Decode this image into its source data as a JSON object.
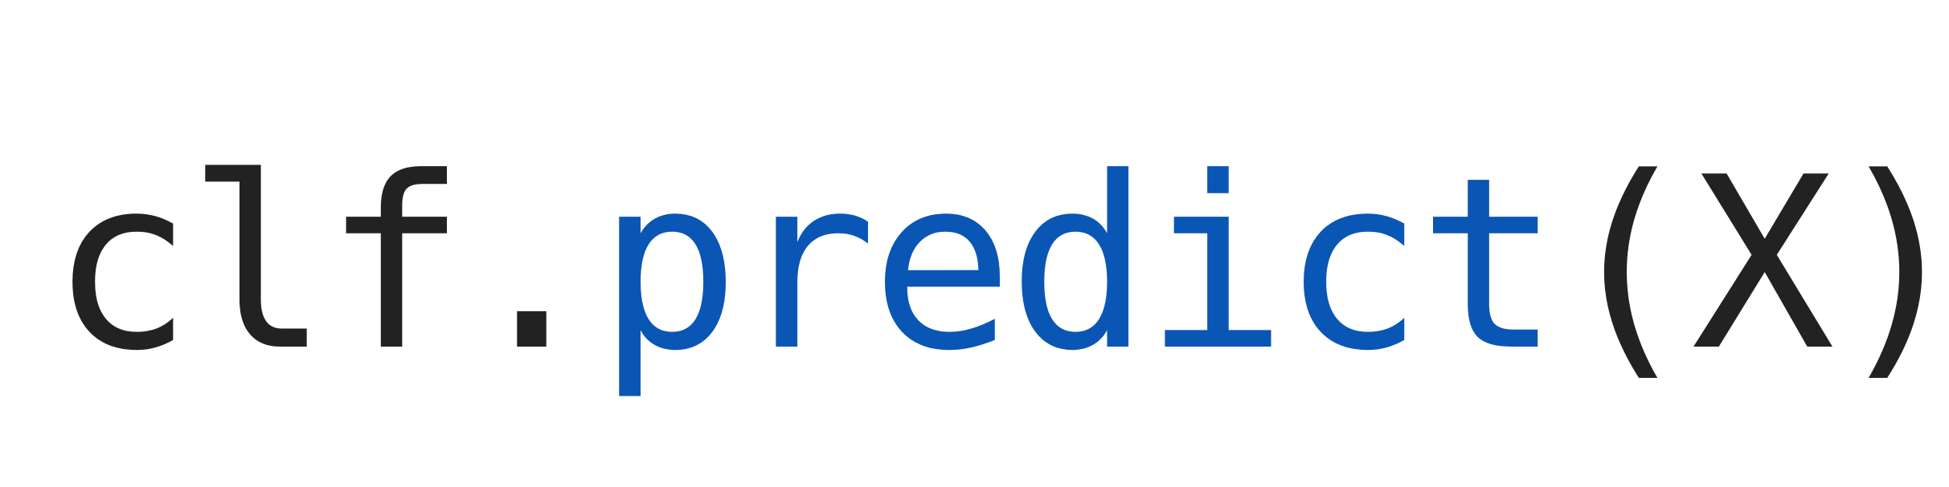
{
  "code": {
    "object": "clf",
    "dot": ".",
    "method": "predict",
    "open_paren": "(",
    "argument": "X",
    "close_paren": ")"
  },
  "colors": {
    "text": "#222222",
    "method": "#0a56b5",
    "background": "#ffffff"
  }
}
